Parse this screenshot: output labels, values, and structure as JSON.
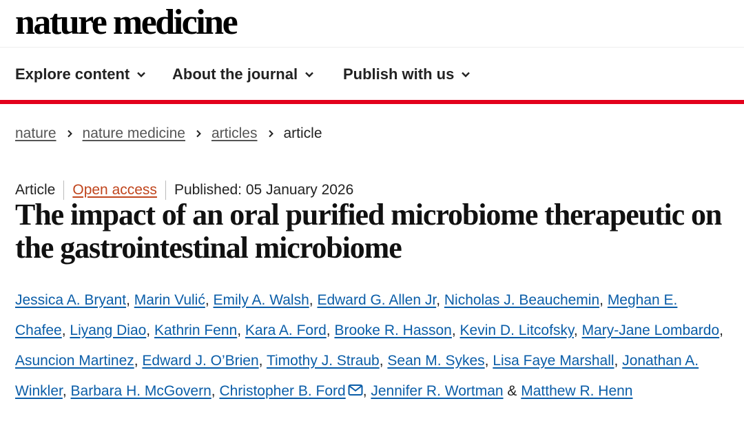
{
  "brand": {
    "logo_text": "nature medicine"
  },
  "nav": {
    "items": [
      {
        "label": "Explore content"
      },
      {
        "label": "About the journal"
      },
      {
        "label": "Publish with us"
      }
    ]
  },
  "breadcrumb": {
    "items": [
      {
        "label": "nature"
      },
      {
        "label": "nature medicine"
      },
      {
        "label": "articles"
      },
      {
        "label": "article"
      }
    ]
  },
  "article": {
    "type": "Article",
    "access": "Open access",
    "published": "Published: 05 January 2026",
    "title": "The impact of an oral purified microbiome therapeutic on the gastrointestinal microbiome",
    "authors": [
      "Jessica A. Bryant",
      "Marin Vulić",
      "Emily A. Walsh",
      "Edward G. Allen Jr",
      "Nicholas J. Beauchemin",
      "Meghan E. Chafee",
      "Liyang Diao",
      "Kathrin Fenn",
      "Kara A. Ford",
      "Brooke R. Hasson",
      "Kevin D. Litcofsky",
      "Mary-Jane Lombardo",
      "Asuncion Martinez",
      "Edward J. O’Brien",
      "Timothy J. Straub",
      "Sean M. Sykes",
      "Lisa Faye Marshall",
      "Jonathan A. Winkler",
      "Barbara H. McGovern",
      "Christopher B. Ford",
      "Jennifer R. Wortman",
      "Matthew R. Henn"
    ],
    "author_separator": ", ",
    "final_conjunction": " & ",
    "corresponding_author_icon": "mail-icon"
  },
  "colors": {
    "accent_red": "#e3001b",
    "link_blue": "#0a5da8",
    "open_access_orange": "#c0451d"
  }
}
